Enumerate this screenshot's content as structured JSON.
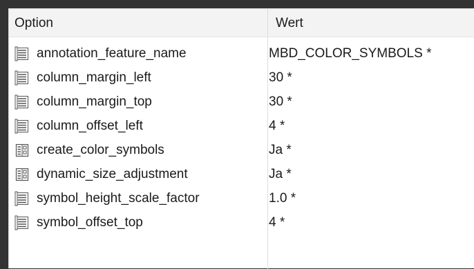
{
  "table": {
    "headers": {
      "option": "Option",
      "value": "Wert"
    },
    "rows": [
      {
        "name": "annotation_feature_name",
        "value": "MBD_COLOR_SYMBOLS *",
        "icon": "text-list-icon"
      },
      {
        "name": "column_margin_left",
        "value": "30 *",
        "icon": "text-list-icon"
      },
      {
        "name": "column_margin_top",
        "value": "30 *",
        "icon": "text-list-icon"
      },
      {
        "name": "column_offset_left",
        "value": "4 *",
        "icon": "text-list-icon"
      },
      {
        "name": "create_color_symbols",
        "value": "Ja *",
        "icon": "boolean-list-icon"
      },
      {
        "name": "dynamic_size_adjustment",
        "value": "Ja *",
        "icon": "boolean-list-icon"
      },
      {
        "name": "symbol_height_scale_factor",
        "value": "1.0 *",
        "icon": "text-list-icon"
      },
      {
        "name": "symbol_offset_top",
        "value": "4 *",
        "icon": "text-list-icon"
      }
    ]
  },
  "colors": {
    "background": "#333333",
    "panel": "#ffffff",
    "header": "#f3f3f3",
    "text": "#1a1a1a",
    "icon": "#555555"
  }
}
